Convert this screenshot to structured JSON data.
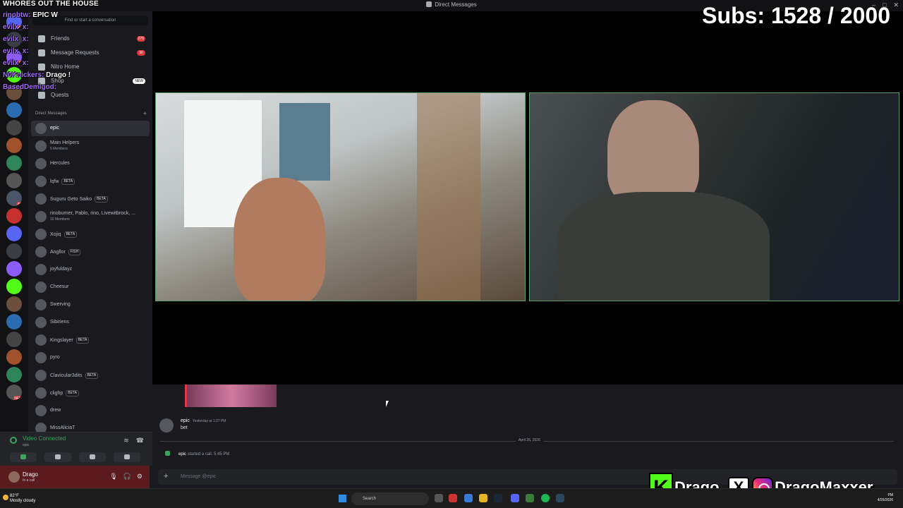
{
  "window": {
    "title": "Direct Messages"
  },
  "overlay": {
    "stream_title": "WHORES OUT THE HOUSE",
    "subs": "Subs: 1528 / 2000",
    "chat": [
      {
        "user": "rinobtw:",
        "msg": "EPIC W"
      },
      {
        "user": "evilx_x:",
        "msg": ""
      },
      {
        "user": "evilx_x:",
        "msg": ""
      },
      {
        "user": "evilx_x:",
        "msg": ""
      },
      {
        "user": "evilx_x:",
        "msg": ""
      },
      {
        "user": "N0Knickers:",
        "msg": "Drago !"
      },
      {
        "user": "BasedDemigod:",
        "msg": ""
      }
    ],
    "social": {
      "kick_handle": "Drago",
      "ig_handle": "DragoMaxxer"
    }
  },
  "sidebar": {
    "search_placeholder": "Find or start a conversation",
    "nav": [
      {
        "label": "Friends",
        "count": "276"
      },
      {
        "label": "Message Requests",
        "count": "30"
      },
      {
        "label": "Nitro Home",
        "count": ""
      },
      {
        "label": "Shop",
        "badge": "NEW"
      },
      {
        "label": "Quests",
        "count": ""
      }
    ],
    "dm_header": "Direct Messages",
    "dms": [
      {
        "name": "epic",
        "sub": "",
        "tag": ""
      },
      {
        "name": "Main Helpers",
        "sub": "5 Members",
        "tag": ""
      },
      {
        "name": "Hercules",
        "sub": "",
        "tag": ""
      },
      {
        "name": "lqfw",
        "sub": "",
        "tag": "BETA"
      },
      {
        "name": "Suguru Geto Saiko",
        "sub": "",
        "tag": "BETA"
      },
      {
        "name": "rinoburner, Pablo, rino, Livewitbrock, ...",
        "sub": "10 Members",
        "tag": ""
      },
      {
        "name": "Xojiq",
        "sub": "",
        "tag": "BETA"
      },
      {
        "name": "Angllor",
        "sub": "",
        "tag": "FISH"
      },
      {
        "name": "joyfuldayz",
        "sub": "",
        "tag": ""
      },
      {
        "name": "Cheesur",
        "sub": "",
        "tag": ""
      },
      {
        "name": "Swerving",
        "sub": "",
        "tag": ""
      },
      {
        "name": "Sibiriens",
        "sub": "",
        "tag": ""
      },
      {
        "name": "Kingslayer",
        "sub": "",
        "tag": "BETA"
      },
      {
        "name": "pyro",
        "sub": "",
        "tag": ""
      },
      {
        "name": "Clavicular3dits",
        "sub": "",
        "tag": "BETA"
      },
      {
        "name": "clighp",
        "sub": "",
        "tag": "BETA"
      },
      {
        "name": "drew",
        "sub": "",
        "tag": ""
      },
      {
        "name": "MissAliciaT",
        "sub": "",
        "tag": ""
      }
    ]
  },
  "server_badges": [
    "306",
    "",
    "123",
    "",
    "",
    "",
    "",
    "",
    "",
    "",
    "80",
    "",
    "",
    "",
    "",
    "",
    "",
    "",
    "",
    "",
    "",
    "NEW"
  ],
  "voice": {
    "title": "Video Connected",
    "channel": "epic"
  },
  "user": {
    "name": "Drago",
    "status": "In a call"
  },
  "chat": {
    "messages": [
      {
        "author": "epic",
        "time": "Yesterday at 1:27 PM",
        "text": "bet"
      }
    ],
    "date_divider": "April 26, 2026",
    "call_event": {
      "author": "epic",
      "text": "started a call.",
      "time": "5:45 PM"
    },
    "composer_placeholder": "Message @epic"
  },
  "taskbar": {
    "weather_temp": "82°F",
    "weather_desc": "Mostly cloudy",
    "search_label": "Search",
    "time": "PM",
    "date": "4/26/2026"
  },
  "colors": {
    "accent_green": "#3ba55d",
    "badge_red": "#da373c",
    "chat_user": "#a56bff",
    "kick_green": "#53fc18"
  }
}
